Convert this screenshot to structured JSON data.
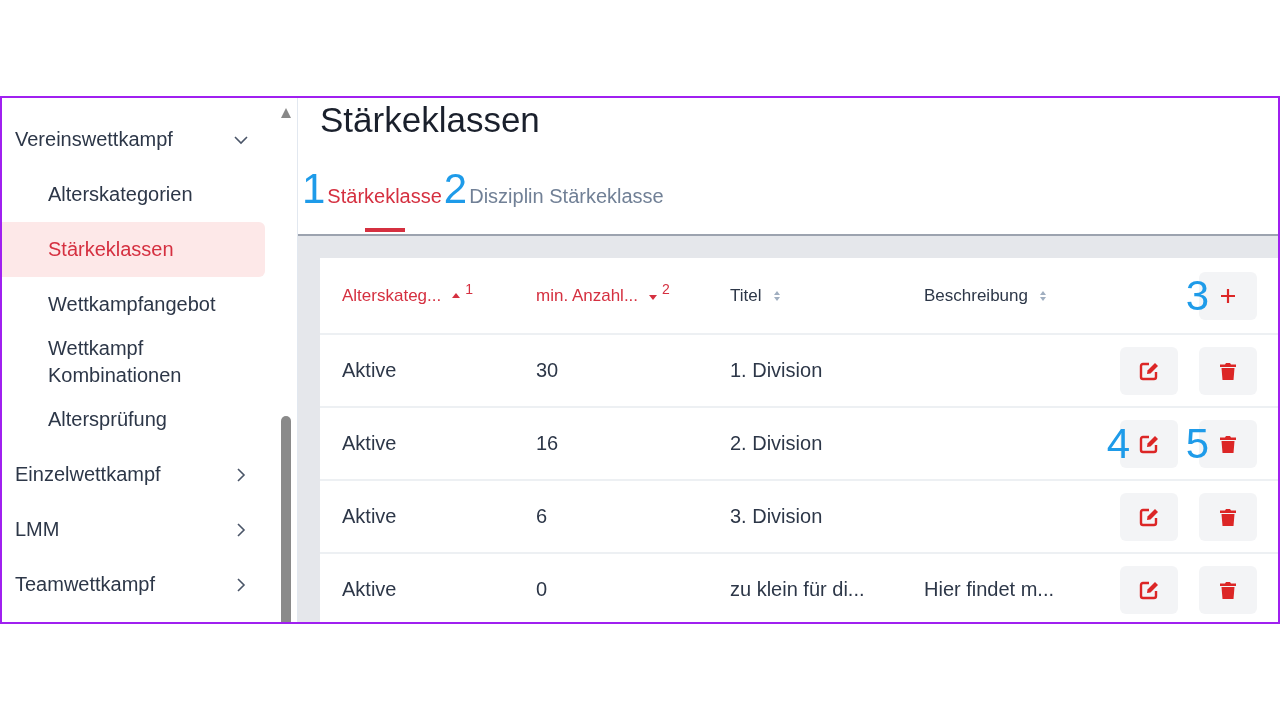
{
  "sidebar": {
    "items": [
      {
        "label": "Vereinswettkampf",
        "expanded": true,
        "children": [
          {
            "label": "Alterskategorien",
            "selected": false
          },
          {
            "label": "Stärkeklassen",
            "selected": true
          },
          {
            "label": "Wettkampfangebot",
            "selected": false
          },
          {
            "label": "Wettkampf Kombinationen",
            "selected": false
          },
          {
            "label": "Altersprüfung",
            "selected": false
          }
        ]
      },
      {
        "label": "Einzelwettkampf",
        "expanded": false
      },
      {
        "label": "LMM",
        "expanded": false
      },
      {
        "label": "Teamwettkampf",
        "expanded": false
      }
    ]
  },
  "page_title": "Stärkeklassen",
  "tabs": [
    {
      "callout": "1",
      "label": "Stärkeklasse",
      "selected": true
    },
    {
      "callout": "2",
      "label": "Disziplin Stärkeklasse",
      "selected": false
    }
  ],
  "table": {
    "columns": [
      {
        "label": "Alterskateg...",
        "sorted": true,
        "descending": false,
        "sort_rank": "1"
      },
      {
        "label": "min. Anzahl...",
        "sorted": true,
        "descending": true,
        "sort_rank": "2"
      },
      {
        "label": "Titel",
        "sorted": false
      },
      {
        "label": "Beschreibung",
        "sorted": false
      }
    ],
    "add_button": {
      "callout": "3"
    },
    "rows": [
      {
        "cells": [
          "Aktive",
          "30",
          "1. Division",
          ""
        ]
      },
      {
        "cells": [
          "Aktive",
          "16",
          "2. Division",
          ""
        ],
        "edit_callout": "4",
        "delete_callout": "5"
      },
      {
        "cells": [
          "Aktive",
          "6",
          "3. Division",
          ""
        ]
      },
      {
        "cells": [
          "Aktive",
          "0",
          "zu klein für di...",
          "Hier findet m..."
        ]
      }
    ]
  }
}
